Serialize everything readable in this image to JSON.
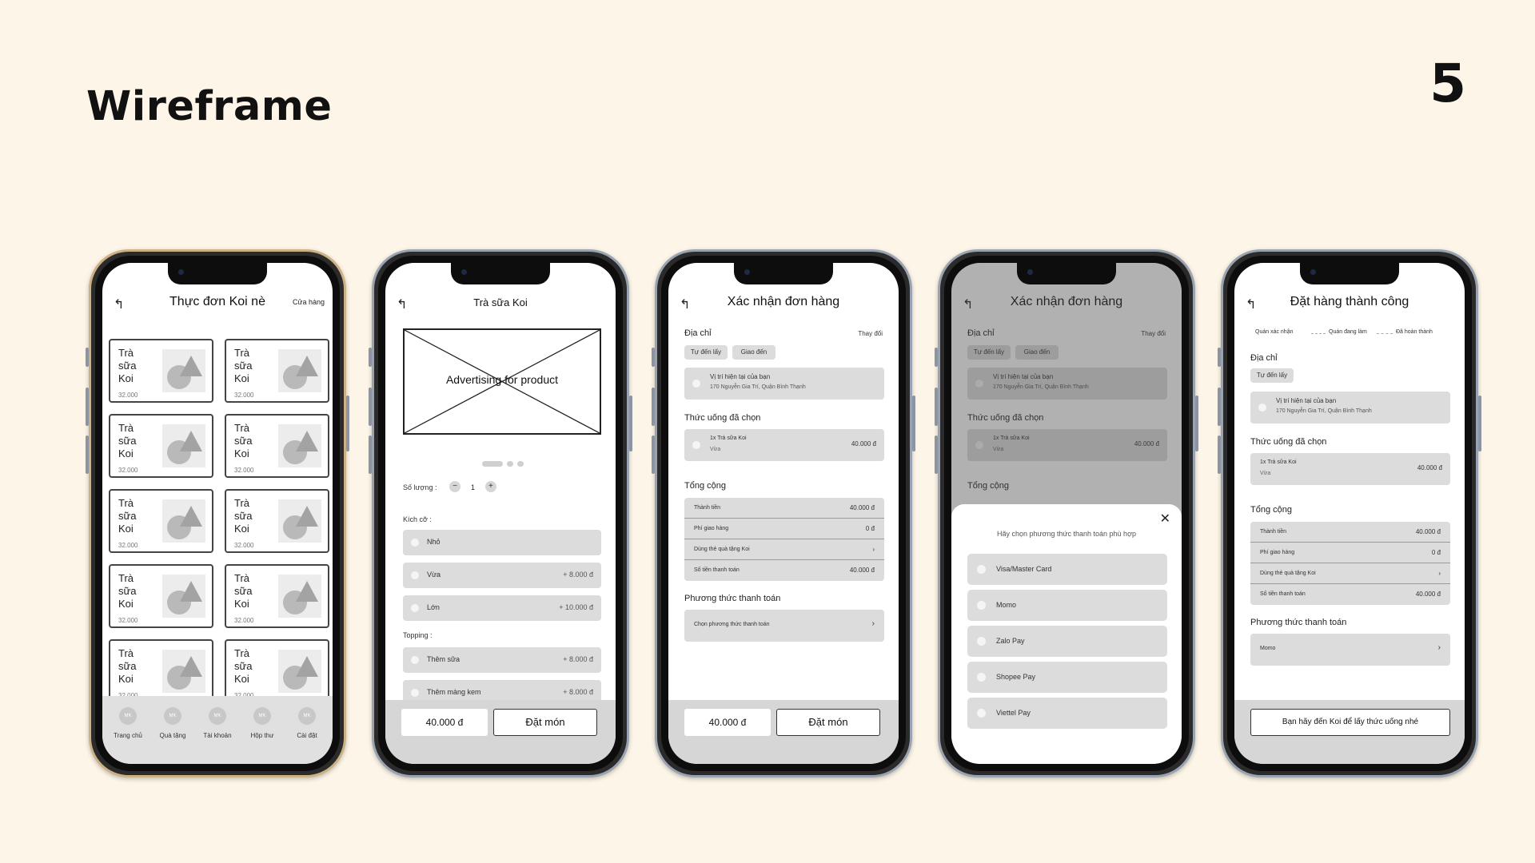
{
  "slide": {
    "title": "Wireframe",
    "page_number": "5"
  },
  "screen1": {
    "back": "↰",
    "title": "Thực đơn Koi nè",
    "right": "Cửa hàng",
    "card_title": "Trà\nsữa\nKoi",
    "card_price": "32.000",
    "tabs": [
      {
        "icon": "MK",
        "label": "Trang chủ"
      },
      {
        "icon": "MK",
        "label": "Quà tặng"
      },
      {
        "icon": "MK",
        "label": "Tài khoản"
      },
      {
        "icon": "MK",
        "label": "Hộp thư"
      },
      {
        "icon": "MK",
        "label": "Cài đặt"
      }
    ]
  },
  "screen2": {
    "back": "↰",
    "title": "Trà sữa Koi",
    "ad_text": "Advertising for product",
    "qty_label": "Số lượng :",
    "qty_minus": "−",
    "qty_value": "1",
    "qty_plus": "+",
    "size_label": "Kích cỡ :",
    "sizes": [
      {
        "label": "Nhỏ",
        "price": ""
      },
      {
        "label": "Vừa",
        "price": "+ 8.000 đ"
      },
      {
        "label": "Lớn",
        "price": "+ 10.000 đ"
      }
    ],
    "topping_label": "Topping :",
    "toppings": [
      {
        "label": "Thêm sữa",
        "price": "+ 8.000 đ"
      },
      {
        "label": "Thêm màng kem",
        "price": "+ 8.000 đ"
      }
    ],
    "total": "40.000 đ",
    "order": "Đặt món"
  },
  "screen3": {
    "back": "↰",
    "title": "Xác nhận đơn hàng",
    "address_label": "Địa chỉ",
    "change": "Thay đổi",
    "pill_pickup": "Tự đến lấy",
    "pill_delivery": "Giao đến",
    "addr_line1": "Vị trí hiện tại của bạn",
    "addr_line2": "170 Nguyễn Gia Trí, Quận Bình Thạnh",
    "drinks_label": "Thức uống đã chọn",
    "item_name": "1x Trà sữa Koi",
    "item_size": "Vừa",
    "item_price": "40.000 đ",
    "total_label": "Tổng cộng",
    "totals": [
      {
        "k": "Thành tiền",
        "v": "40.000 đ"
      },
      {
        "k": "Phí giao hàng",
        "v": "0 đ"
      },
      {
        "k": "Dùng thẻ quà tặng Koi",
        "v": "›"
      },
      {
        "k": "Số tiền thanh toán",
        "v": "40.000 đ"
      }
    ],
    "pay_label": "Phương thức thanh toán",
    "pay_choose": "Chọn phương thức thanh toán",
    "pay_arrow": "›",
    "total": "40.000 đ",
    "order": "Đặt món"
  },
  "screen4": {
    "back": "↰",
    "title": "Xác nhận đơn hàng",
    "address_label": "Địa chỉ",
    "change": "Thay đổi",
    "pill_pickup": "Tự đến lấy",
    "pill_delivery": "Giao đến",
    "addr_line1": "Vị trí hiện tại của bạn",
    "addr_line2": "170 Nguyễn Gia Trí, Quận Bình Thạnh",
    "drinks_label": "Thức uống đã chọn",
    "item_name": "1x Trà sữa Koi",
    "item_size": "Vừa",
    "item_price": "40.000 đ",
    "total_label": "Tổng cộng",
    "close": "✕",
    "prompt": "Hãy chọn phương thức thanh toán phù hợp",
    "options": [
      "Visa/Master Card",
      "Momo",
      "Zalo Pay",
      "Shopee Pay",
      "Viettel Pay"
    ]
  },
  "screen5": {
    "back": "↰",
    "title": "Đặt hàng thành công",
    "steps": [
      "Quán xác nhận",
      "Quán đang làm",
      "Đã hoàn thành"
    ],
    "address_label": "Địa chỉ",
    "pill_pickup": "Tự đến lấy",
    "addr_line1": "Vị trí hiện tại của bạn",
    "addr_line2": "170 Nguyễn Gia Trí, Quận Bình Thạnh",
    "drinks_label": "Thức uống đã chọn",
    "item_name": "1x Trà sữa Koi",
    "item_size": "Vừa",
    "item_price": "40.000 đ",
    "total_label": "Tổng cộng",
    "totals": [
      {
        "k": "Thành tiền",
        "v": "40.000 đ"
      },
      {
        "k": "Phí giao hàng",
        "v": "0 đ"
      },
      {
        "k": "Dùng thẻ quà tặng Koi",
        "v": "›"
      },
      {
        "k": "Số tiền thanh toán",
        "v": "40.000 đ"
      }
    ],
    "pay_label": "Phương thức thanh toán",
    "pay_value": "Momo",
    "pay_arrow": "›",
    "notice": "Bạn hãy đến Koi để lấy thức uống nhé"
  }
}
